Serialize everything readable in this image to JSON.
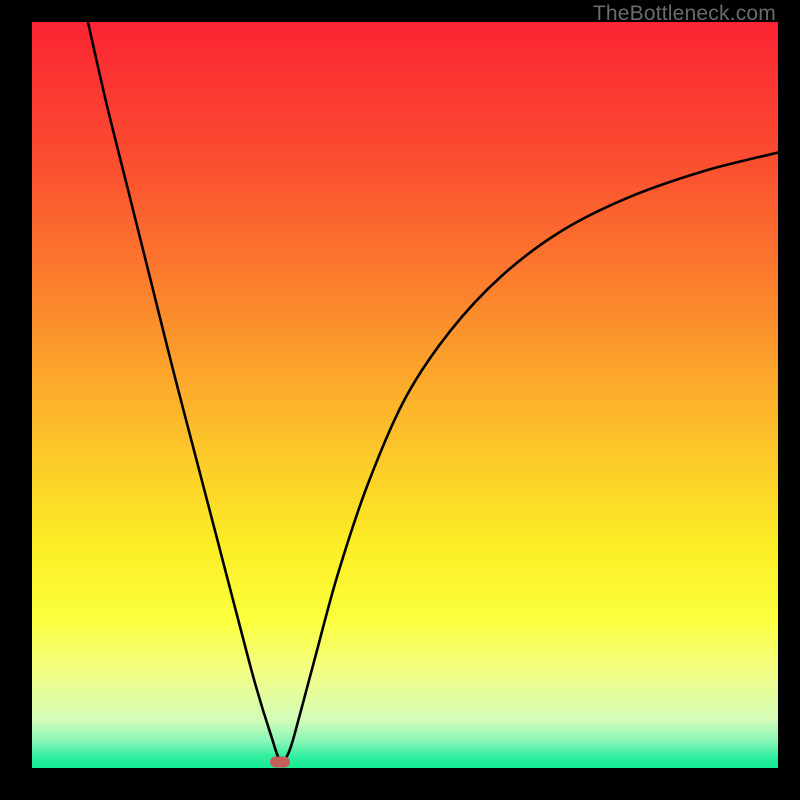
{
  "watermark": "TheBottleneck.com",
  "chart_data": {
    "type": "line",
    "title": "",
    "xlabel": "",
    "ylabel": "",
    "xlim": [
      0,
      100
    ],
    "ylim": [
      0,
      100
    ],
    "grid": false,
    "legend": false,
    "gradient_stops": [
      {
        "pos": 0.0,
        "color": "#fb2433"
      },
      {
        "pos": 0.18,
        "color": "#fb4c30"
      },
      {
        "pos": 0.36,
        "color": "#fb812d"
      },
      {
        "pos": 0.54,
        "color": "#fcbc2a"
      },
      {
        "pos": 0.7,
        "color": "#fced26"
      },
      {
        "pos": 0.8,
        "color": "#fbff3c"
      },
      {
        "pos": 0.87,
        "color": "#f2fe84"
      },
      {
        "pos": 0.935,
        "color": "#d4fcb8"
      },
      {
        "pos": 0.965,
        "color": "#86f6b8"
      },
      {
        "pos": 0.985,
        "color": "#2fee9e"
      },
      {
        "pos": 1.0,
        "color": "#13ec95"
      }
    ],
    "series": [
      {
        "name": "bottleneck-curve",
        "color": "#000000",
        "x": [
          7.5,
          10,
          13,
          16,
          19,
          22,
          25,
          28,
          30,
          32,
          33.3,
          34.5,
          36,
          38,
          41,
          45,
          50,
          56,
          63,
          71,
          80,
          90,
          100
        ],
        "y": [
          100,
          89,
          77,
          65,
          53,
          41.5,
          30,
          18.5,
          11,
          4.5,
          1,
          2.3,
          7.5,
          15,
          26,
          38,
          49.5,
          58.5,
          66,
          72,
          76.5,
          80,
          82.5
        ]
      }
    ],
    "min_marker": {
      "x": 33.3,
      "y": 0.8,
      "color": "#c35f5b"
    }
  }
}
